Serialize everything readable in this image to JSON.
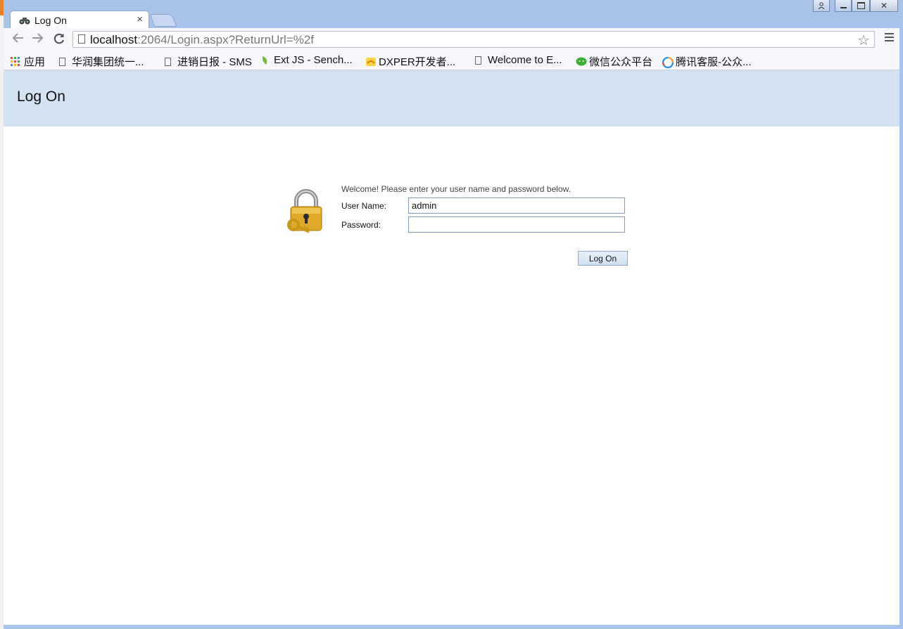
{
  "browser": {
    "tab_title": "Log On",
    "tab_close": "×",
    "address_host": "localhost",
    "address_rest": ":2064/Login.aspx?ReturnUrl=%2f",
    "bookmarks": [
      {
        "label": "应用",
        "icon": "apps-grid-icon"
      },
      {
        "label": "华润集团统一...",
        "icon": "page-icon"
      },
      {
        "label": "进销日报 - SMS",
        "icon": "page-icon"
      },
      {
        "label": "Ext JS - Sench...",
        "icon": "extjs-leaf-icon"
      },
      {
        "label": "DXPER开发者...",
        "icon": "dxper-icon"
      },
      {
        "label": "Welcome to E...",
        "icon": "page-icon"
      },
      {
        "label": "微信公众平台",
        "icon": "wechat-icon"
      },
      {
        "label": "腾讯客服-公众...",
        "icon": "tencent-icon"
      }
    ]
  },
  "page": {
    "title": "Log On",
    "welcome": "Welcome! Please enter your user name and password below.",
    "username_label": "User Name:",
    "username_value": "admin",
    "password_label": "Password:",
    "password_value": "",
    "logon_button": "Log On"
  },
  "colors": {
    "header_bg": "#d3e3f4",
    "frame": "#a9c4ea"
  }
}
